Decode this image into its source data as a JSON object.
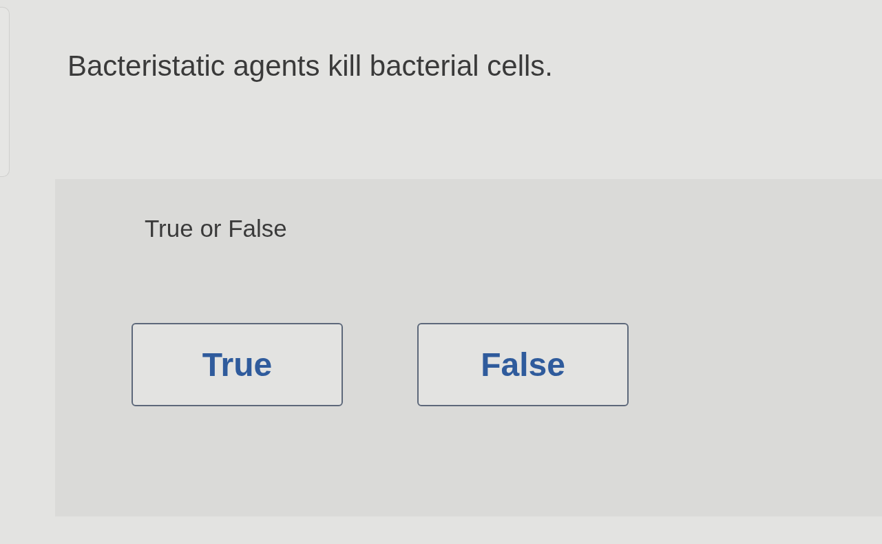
{
  "question": "Bacteristatic agents kill bacterial cells.",
  "answer_panel": {
    "instruction": "True or False",
    "options": [
      {
        "label": "True",
        "selected": false
      },
      {
        "label": "False",
        "selected": false
      }
    ]
  }
}
